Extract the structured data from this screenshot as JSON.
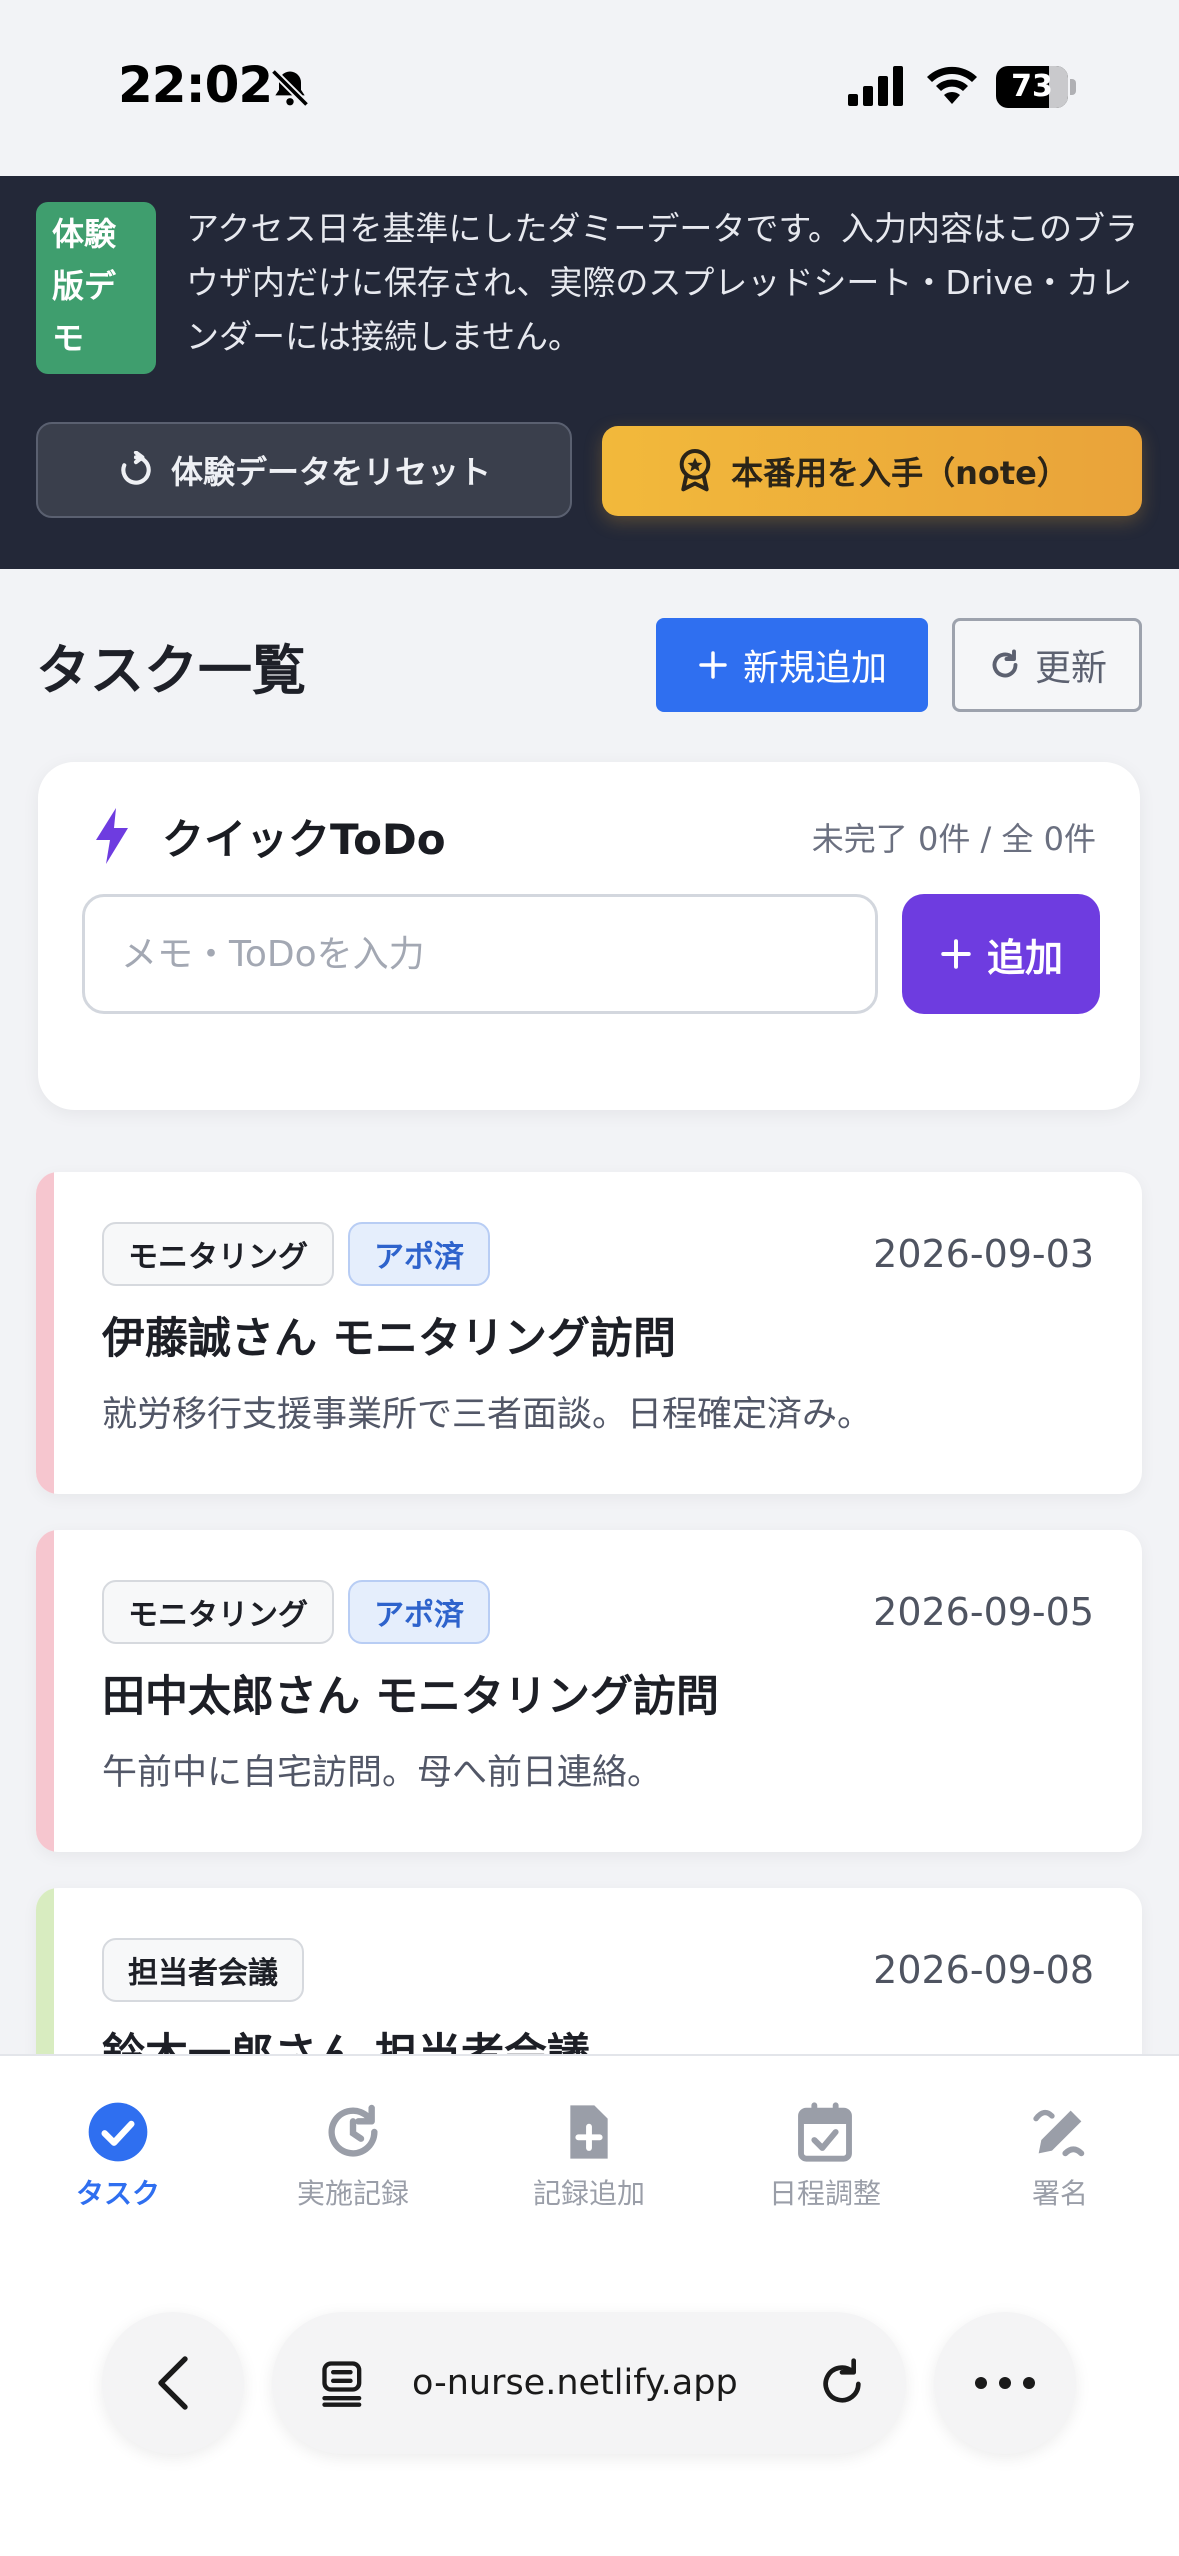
{
  "status_bar": {
    "time": "22:02",
    "battery": "73",
    "battery_level": 0.73
  },
  "demo_banner": {
    "badge": "体験版デモ",
    "message": "アクセス日を基準にしたダミーデータです。入力内容はこのブラウザ内だけに保存され、実際のスプレッドシート・Drive・カレンダーには接続しません。",
    "reset_label": "体験データをリセット",
    "get_label": "本番用を入手（note）"
  },
  "header": {
    "title": "タスク一覧",
    "new_label": "新規追加",
    "refresh_label": "更新"
  },
  "quick_todo": {
    "title": "クイックToDo",
    "count": "未完了 0件 / 全 0件",
    "input_value": "",
    "placeholder": "メモ・ToDoを入力",
    "add_label": "追加"
  },
  "tasks": [
    {
      "category": "モニタリング",
      "status": "アポ済",
      "date": "2026-09-03",
      "title": "伊藤誠さん モニタリング訪問",
      "note": "就労移行支援事業所で三者面談。日程確定済み。",
      "accent": "#f6c6cf"
    },
    {
      "category": "モニタリング",
      "status": "アポ済",
      "date": "2026-09-05",
      "title": "田中太郎さん モニタリング訪問",
      "note": "午前中に自宅訪問。母へ前日連絡。",
      "accent": "#f6c6cf"
    },
    {
      "category": "担当者会議",
      "date": "2026-09-08",
      "title": "鈴木一郎さん 担当者会議",
      "note": "",
      "accent": "#d8ecc0"
    }
  ],
  "bottom_nav": [
    {
      "label": "タスク",
      "icon": "check-circle-icon",
      "active": true
    },
    {
      "label": "実施記録",
      "icon": "history-icon",
      "active": false
    },
    {
      "label": "記録追加",
      "icon": "file-plus-icon",
      "active": false
    },
    {
      "label": "日程調整",
      "icon": "calendar-check-icon",
      "active": false
    },
    {
      "label": "署名",
      "icon": "signature-icon",
      "active": false
    }
  ],
  "browser": {
    "url": "o-nurse.netlify.app"
  },
  "colors": {
    "primary": "#2f6ff0",
    "accent_purple": "#6e3ce0",
    "banner_bg": "#232838",
    "gold": "#f2b93b",
    "demo_green": "#3f9e6e"
  }
}
